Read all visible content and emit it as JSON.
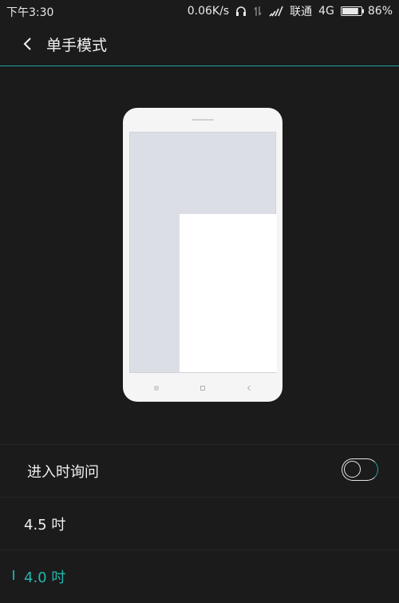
{
  "status_bar": {
    "time": "下午3:30",
    "speed": "0.06K/s",
    "carrier": "联通",
    "network": "4G",
    "battery": "86%",
    "battery_level": 0.86
  },
  "header": {
    "title": "单手模式"
  },
  "settings": {
    "ask_on_enter": {
      "label": "进入时询问",
      "enabled": false
    },
    "sizes": [
      {
        "label": "4.5 吋",
        "selected": false
      },
      {
        "label": "4.0 吋",
        "selected": true
      }
    ]
  },
  "colors": {
    "accent": "#1aa6a0",
    "background": "#1b1b1b"
  }
}
